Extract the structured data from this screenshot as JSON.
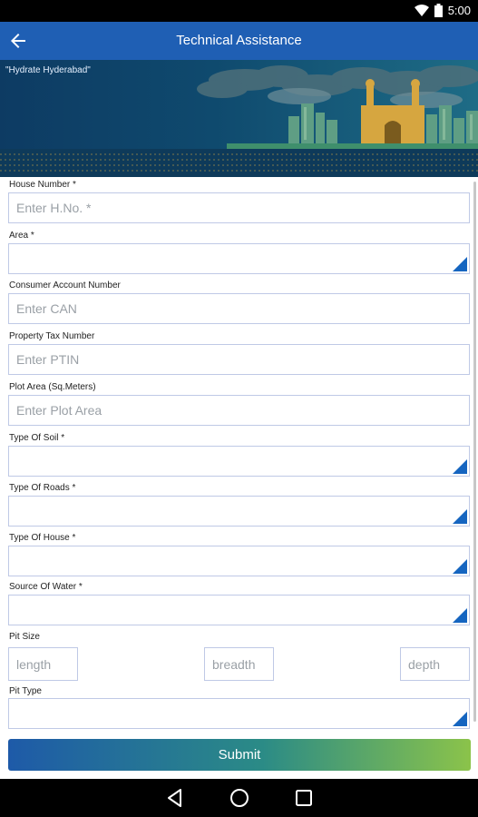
{
  "status_bar": {
    "time": "5:00"
  },
  "app_bar": {
    "title": "Technical Assistance"
  },
  "banner": {
    "tagline": "\"Hydrate Hyderabad\""
  },
  "form": {
    "house_number": {
      "label": "House Number *",
      "placeholder": "Enter H.No. *"
    },
    "area": {
      "label": "Area *"
    },
    "consumer_account_number": {
      "label": "Consumer Account Number",
      "placeholder": "Enter CAN"
    },
    "property_tax_number": {
      "label": "Property Tax Number",
      "placeholder": "Enter PTIN"
    },
    "plot_area": {
      "label": "Plot Area (Sq.Meters)",
      "placeholder": "Enter Plot Area"
    },
    "type_of_soil": {
      "label": "Type Of Soil *"
    },
    "type_of_roads": {
      "label": "Type Of Roads *"
    },
    "type_of_house": {
      "label": "Type Of House *"
    },
    "source_of_water": {
      "label": "Source Of Water *"
    },
    "pit_size": {
      "label": "Pit Size",
      "length_placeholder": "length",
      "breadth_placeholder": "breadth",
      "depth_placeholder": "depth"
    },
    "pit_type": {
      "label": "Pit Type"
    }
  },
  "submit_label": "Submit",
  "colors": {
    "app_bar": "#1f5fb4",
    "dropdown_indicator": "#1565c0",
    "field_border": "#bfc9e6"
  }
}
